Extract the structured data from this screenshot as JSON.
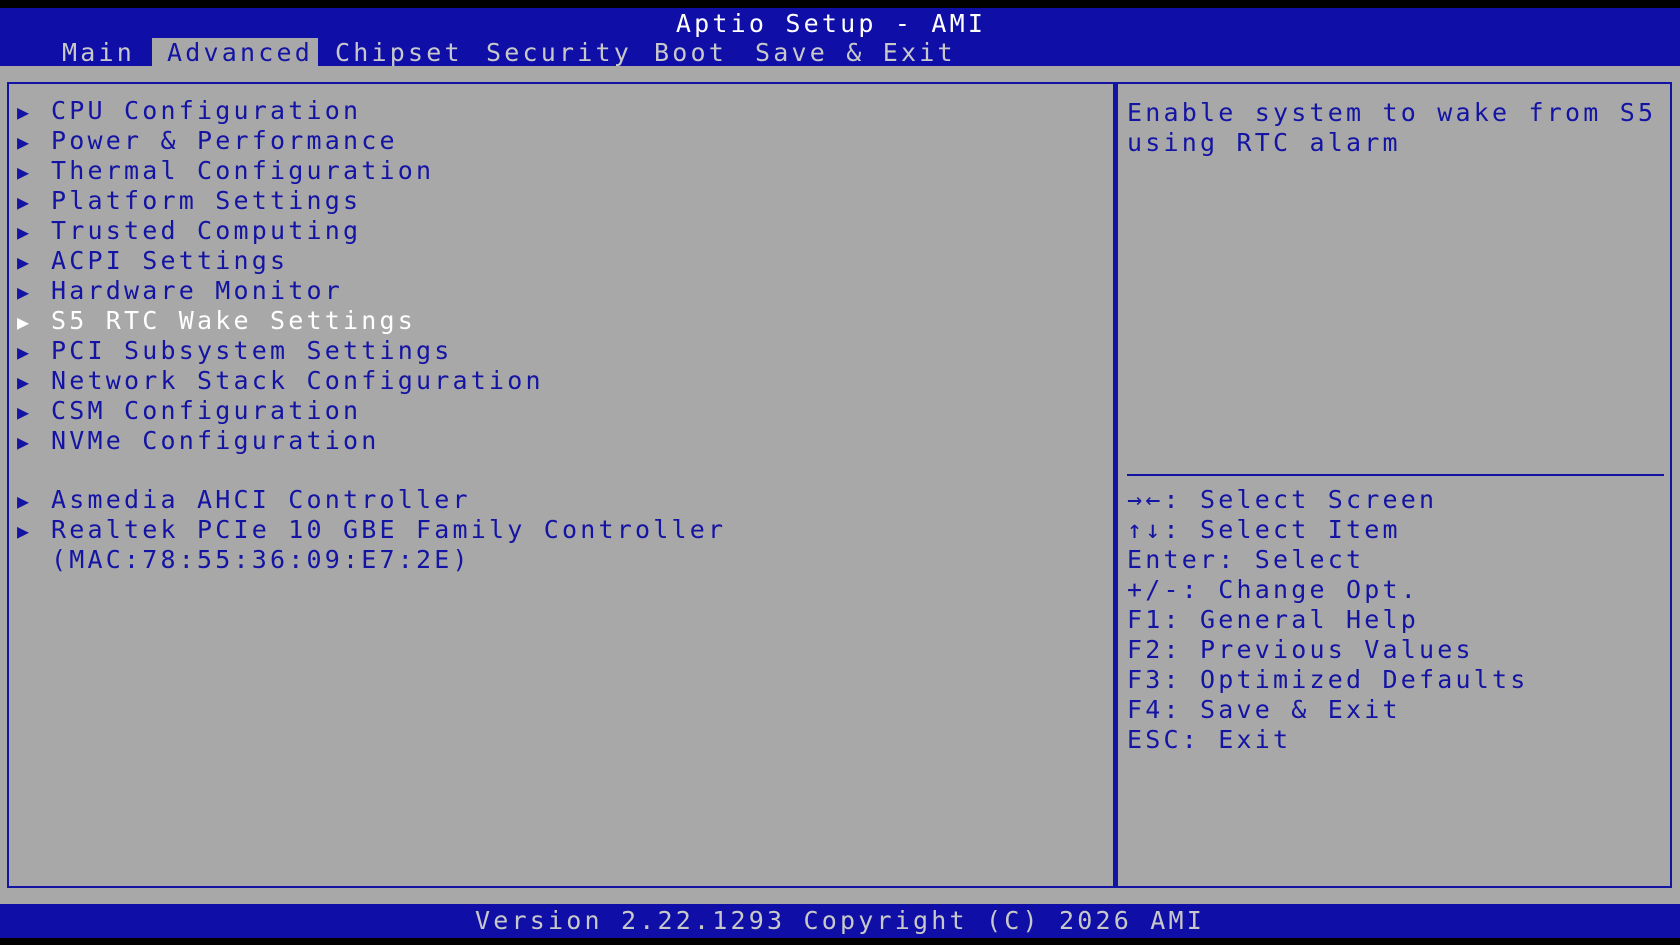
{
  "header": {
    "title": "Aptio Setup - AMI",
    "tabs": [
      {
        "label": "Main"
      },
      {
        "label": "Advanced"
      },
      {
        "label": "Chipset"
      },
      {
        "label": "Security"
      },
      {
        "label": "Boot"
      },
      {
        "label": "Save & Exit"
      }
    ],
    "active_tab": "Advanced"
  },
  "menu": {
    "items": [
      {
        "label": "CPU Configuration"
      },
      {
        "label": "Power & Performance"
      },
      {
        "label": "Thermal Configuration"
      },
      {
        "label": "Platform Settings"
      },
      {
        "label": "Trusted Computing"
      },
      {
        "label": "ACPI Settings"
      },
      {
        "label": "Hardware Monitor"
      },
      {
        "label": "S5 RTC Wake Settings"
      },
      {
        "label": "PCI Subsystem Settings"
      },
      {
        "label": "Network Stack Configuration"
      },
      {
        "label": "CSM Configuration"
      },
      {
        "label": "NVMe Configuration"
      },
      {
        "label": "Asmedia AHCI Controller"
      },
      {
        "label": "Realtek PCIe 10 GBE Family Controller",
        "sub": "(MAC:78:55:36:09:E7:2E)"
      }
    ],
    "selected": "S5 RTC Wake Settings"
  },
  "help": {
    "description": "Enable system to wake from S5 using RTC alarm",
    "keys": [
      {
        "label": "→←: Select Screen"
      },
      {
        "label": "↑↓: Select Item"
      },
      {
        "label": "Enter: Select"
      },
      {
        "label": "+/-: Change Opt."
      },
      {
        "label": "F1: General Help"
      },
      {
        "label": "F2: Previous Values"
      },
      {
        "label": "F3: Optimized Defaults"
      },
      {
        "label": "F4: Save & Exit"
      },
      {
        "label": "ESC: Exit"
      }
    ]
  },
  "footer": {
    "version": "Version 2.22.1293 Copyright (C) 2026 AMI"
  },
  "colors": {
    "title_bar": "#0f0fa8",
    "panel_bg": "#a8a8a8",
    "text_blue": "#1414a4",
    "highlight": "#ffffff",
    "footer_text": "#c8c8c8"
  },
  "icons": {
    "submenu_arrow": "triangle-right-icon"
  }
}
